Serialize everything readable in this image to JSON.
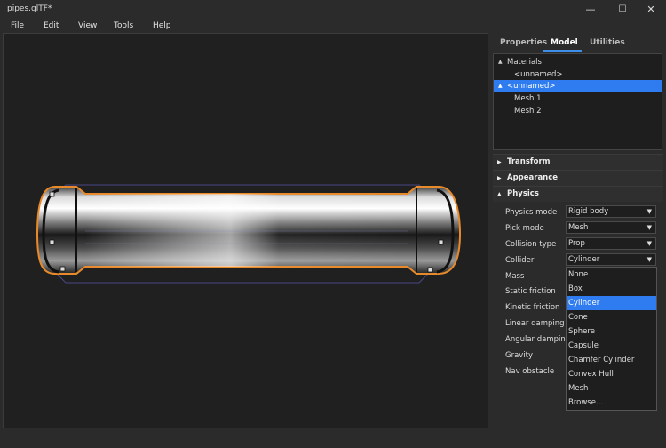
{
  "window": {
    "title": "pipes.glTF*",
    "minimize": "—",
    "maximize": "☐",
    "close": "✕"
  },
  "menu": [
    "File",
    "Edit",
    "View",
    "Tools",
    "Help"
  ],
  "tabs": [
    {
      "label": "Properties",
      "active": false
    },
    {
      "label": "Model",
      "active": true
    },
    {
      "label": "Utilities",
      "active": false
    }
  ],
  "tree": [
    {
      "label": "Materials",
      "expander": "▲",
      "selected": false
    },
    {
      "label": "<unnamed>",
      "expander": "",
      "selected": false
    },
    {
      "label": "<unnamed>",
      "expander": "▲",
      "selected": true
    },
    {
      "label": "Mesh 1",
      "expander": "",
      "selected": false
    },
    {
      "label": "Mesh 2",
      "expander": "",
      "selected": false
    }
  ],
  "sections": [
    {
      "label": "Transform",
      "arrow": "▶"
    },
    {
      "label": "Appearance",
      "arrow": "▶"
    },
    {
      "label": "Physics",
      "arrow": "▲"
    }
  ],
  "physics": {
    "props": [
      {
        "label": "Physics mode",
        "value": "Rigid body"
      },
      {
        "label": "Pick mode",
        "value": "Mesh"
      },
      {
        "label": "Collision type",
        "value": "Prop"
      },
      {
        "label": "Collider",
        "value": "Cylinder"
      },
      {
        "label": "Mass",
        "value": ""
      },
      {
        "label": "Static friction",
        "value": ""
      },
      {
        "label": "Kinetic friction",
        "value": ""
      },
      {
        "label": "Linear damping",
        "value": ""
      },
      {
        "label": "Angular damping",
        "value": ""
      },
      {
        "label": "Gravity",
        "value": ""
      },
      {
        "label": "Nav obstacle",
        "value": ""
      }
    ],
    "caret": "▼",
    "collider_options": [
      "None",
      "Box",
      "Cylinder",
      "Cone",
      "Sphere",
      "Capsule",
      "Chamfer Cylinder",
      "Convex Hull",
      "Mesh",
      "Browse..."
    ],
    "collider_selected": "Cylinder"
  },
  "colors": {
    "accent": "#2f7cf0",
    "selection_outline": "#e8892a",
    "background": "#2b2b2b"
  }
}
